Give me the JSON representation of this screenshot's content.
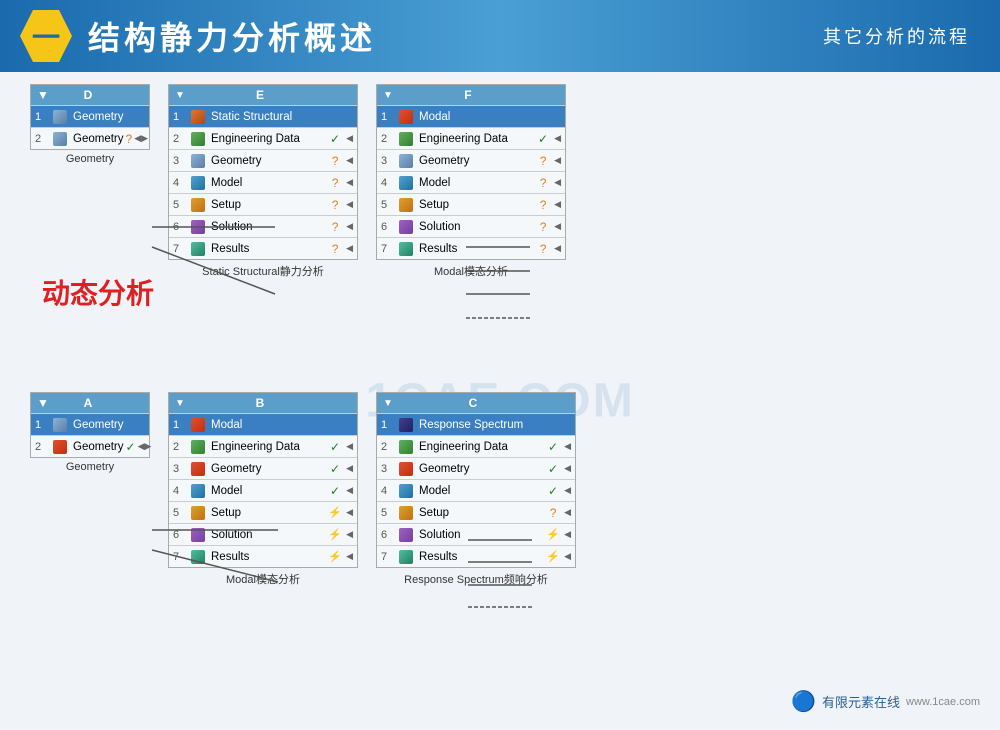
{
  "header": {
    "hexagon_label": "一",
    "title": "结构静力分析概述",
    "subtitle": "其它分析的流程"
  },
  "watermark": "1CAE.COM",
  "dynamic_label": "动态分析",
  "top_section": {
    "box_d": {
      "title": "D",
      "rows": [
        {
          "num": "1",
          "icon": "geo",
          "label": "Geometry",
          "status": "",
          "highlighted": true
        },
        {
          "num": "2",
          "icon": "geo",
          "label": "Geometry",
          "status": "?",
          "highlighted": false
        }
      ],
      "caption": "Geometry"
    },
    "box_e": {
      "title": "E",
      "rows": [
        {
          "num": "1",
          "icon": "static",
          "label": "Static Structural",
          "status": "",
          "highlighted": true
        },
        {
          "num": "2",
          "icon": "eng",
          "label": "Engineering Data",
          "status": "✓",
          "highlighted": false
        },
        {
          "num": "3",
          "icon": "geo",
          "label": "Geometry",
          "status": "?",
          "highlighted": false
        },
        {
          "num": "4",
          "icon": "model",
          "label": "Model",
          "status": "?",
          "highlighted": false
        },
        {
          "num": "5",
          "icon": "setup",
          "label": "Setup",
          "status": "?",
          "highlighted": false
        },
        {
          "num": "6",
          "icon": "solution",
          "label": "Solution",
          "status": "?",
          "highlighted": false
        },
        {
          "num": "7",
          "icon": "results",
          "label": "Results",
          "status": "?",
          "highlighted": false
        }
      ],
      "caption": "Static Structural静力分析"
    },
    "box_f": {
      "title": "F",
      "rows": [
        {
          "num": "1",
          "icon": "modal",
          "label": "Modal",
          "status": "",
          "highlighted": true
        },
        {
          "num": "2",
          "icon": "eng",
          "label": "Engineering Data",
          "status": "✓",
          "highlighted": false
        },
        {
          "num": "3",
          "icon": "geo",
          "label": "Geometry",
          "status": "?",
          "highlighted": false
        },
        {
          "num": "4",
          "icon": "model",
          "label": "Model",
          "status": "?",
          "highlighted": false
        },
        {
          "num": "5",
          "icon": "setup",
          "label": "Setup",
          "status": "?",
          "highlighted": false
        },
        {
          "num": "6",
          "icon": "solution",
          "label": "Solution",
          "status": "?",
          "highlighted": false
        },
        {
          "num": "7",
          "icon": "results",
          "label": "Results",
          "status": "?",
          "highlighted": false
        }
      ],
      "caption": "Modal模态分析"
    }
  },
  "bottom_section": {
    "box_a": {
      "title": "A",
      "rows": [
        {
          "num": "1",
          "icon": "geo",
          "label": "Geometry",
          "status": "",
          "highlighted": true
        },
        {
          "num": "2",
          "icon": "modal",
          "label": "Geometry",
          "status": "✓",
          "highlighted": false
        }
      ],
      "caption": "Geometry"
    },
    "box_b": {
      "title": "B",
      "rows": [
        {
          "num": "1",
          "icon": "modal",
          "label": "Modal",
          "status": "",
          "highlighted": true
        },
        {
          "num": "2",
          "icon": "eng",
          "label": "Engineering Data",
          "status": "✓",
          "highlighted": false
        },
        {
          "num": "3",
          "icon": "modal",
          "label": "Geometry",
          "status": "✓",
          "highlighted": false
        },
        {
          "num": "4",
          "icon": "model",
          "label": "Model",
          "status": "✓",
          "highlighted": false
        },
        {
          "num": "5",
          "icon": "setup",
          "label": "Setup",
          "status": "⚡",
          "highlighted": false
        },
        {
          "num": "6",
          "icon": "solution",
          "label": "Solution",
          "status": "⚡",
          "highlighted": false
        },
        {
          "num": "7",
          "icon": "results",
          "label": "Results",
          "status": "⚡",
          "highlighted": false
        }
      ],
      "caption": "Modal模态分析"
    },
    "box_c": {
      "title": "C",
      "rows": [
        {
          "num": "1",
          "icon": "resp",
          "label": "Response Spectrum",
          "status": "",
          "highlighted": true
        },
        {
          "num": "2",
          "icon": "eng",
          "label": "Engineering Data",
          "status": "✓",
          "highlighted": false
        },
        {
          "num": "3",
          "icon": "modal",
          "label": "Geometry",
          "status": "✓",
          "highlighted": false
        },
        {
          "num": "4",
          "icon": "model",
          "label": "Model",
          "status": "✓",
          "highlighted": false
        },
        {
          "num": "5",
          "icon": "setup",
          "label": "Setup",
          "status": "?",
          "highlighted": false
        },
        {
          "num": "6",
          "icon": "solution",
          "label": "Solution",
          "status": "⚡",
          "highlighted": false
        },
        {
          "num": "7",
          "icon": "results",
          "label": "Results",
          "status": "⚡",
          "highlighted": false
        }
      ],
      "caption": "Response Spectrum频响分析"
    }
  },
  "footer": {
    "logo_text": "有限元素在线",
    "url": "www.1cae.com"
  }
}
